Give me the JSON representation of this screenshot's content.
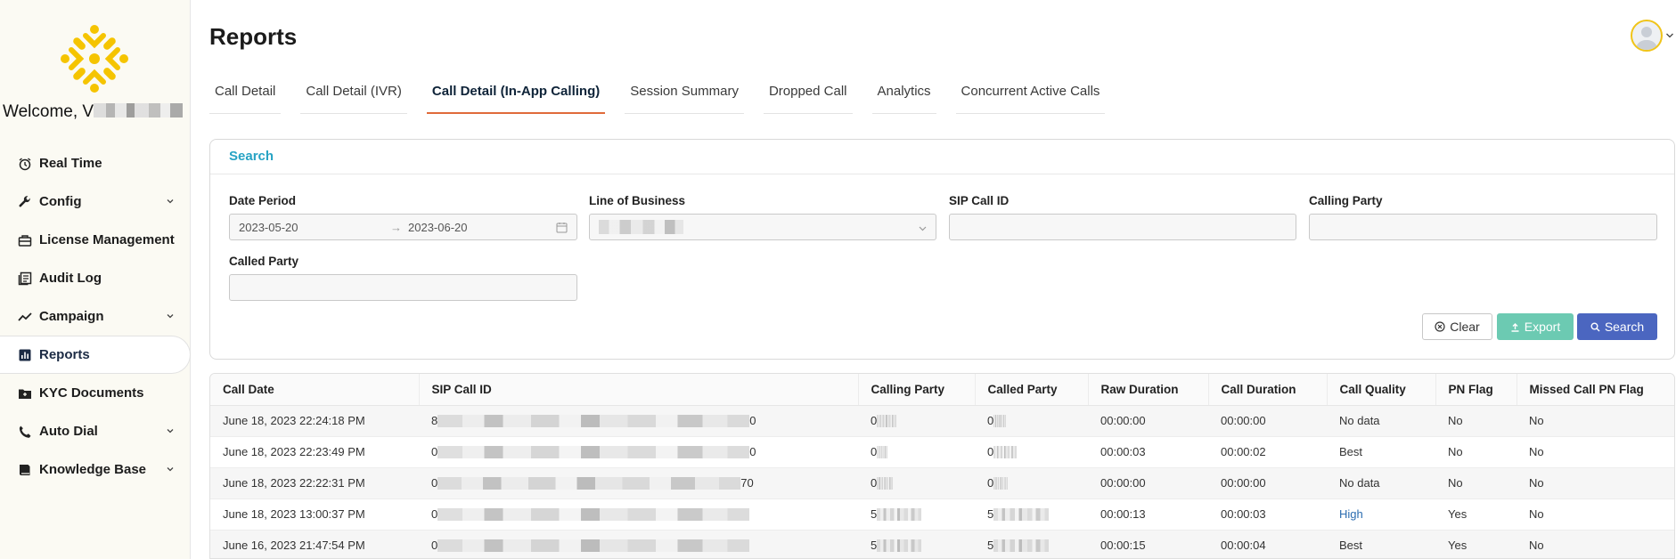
{
  "sidebar": {
    "welcome": "Welcome, V",
    "items": [
      {
        "label": "Real Time",
        "icon": "alarm-clock-icon",
        "expandable": false
      },
      {
        "label": "Config",
        "icon": "wrench-icon",
        "expandable": true
      },
      {
        "label": "License Management",
        "icon": "license-icon",
        "expandable": false
      },
      {
        "label": "Audit Log",
        "icon": "audit-log-icon",
        "expandable": false
      },
      {
        "label": "Campaign",
        "icon": "trend-line-icon",
        "expandable": true
      },
      {
        "label": "Reports",
        "icon": "bar-chart-icon",
        "expandable": false,
        "active": true
      },
      {
        "label": "KYC Documents",
        "icon": "folder-icon",
        "expandable": false
      },
      {
        "label": "Auto Dial",
        "icon": "phone-icon",
        "expandable": true
      },
      {
        "label": "Knowledge Base",
        "icon": "book-icon",
        "expandable": true
      }
    ]
  },
  "header": {
    "title": "Reports"
  },
  "tabs": [
    {
      "label": "Call Detail"
    },
    {
      "label": "Call Detail (IVR)"
    },
    {
      "label": "Call Detail (In-App Calling)",
      "active": true
    },
    {
      "label": "Session Summary"
    },
    {
      "label": "Dropped Call"
    },
    {
      "label": "Analytics"
    },
    {
      "label": "Concurrent Active Calls"
    }
  ],
  "search": {
    "title": "Search",
    "date_period_label": "Date Period",
    "date_start": "2023-05-20",
    "date_end": "2023-06-20",
    "date_separator": "→",
    "line_of_business_label": "Line of Business",
    "sip_call_id_label": "SIP Call ID",
    "calling_party_label": "Calling Party",
    "called_party_label": "Called Party",
    "clear_label": "Clear",
    "export_label": "Export",
    "search_label": "Search"
  },
  "table": {
    "columns": [
      "Call Date",
      "SIP Call ID",
      "Calling Party",
      "Called Party",
      "Raw Duration",
      "Call Duration",
      "Call Quality",
      "PN Flag",
      "Missed Call PN Flag"
    ],
    "rows": [
      {
        "call_date": "June 18, 2023 22:24:18 PM",
        "sip_prefix": "8",
        "sip_suffix": "0",
        "calling": "0",
        "called": "0",
        "raw_duration": "00:00:00",
        "call_duration": "00:00:00",
        "quality": "No data",
        "pn_flag": "No",
        "missed_pn_flag": "No"
      },
      {
        "call_date": "June 18, 2023 22:23:49 PM",
        "sip_prefix": "0",
        "sip_suffix": "0",
        "calling": "0",
        "called": "0",
        "raw_duration": "00:00:03",
        "call_duration": "00:00:02",
        "quality": "Best",
        "pn_flag": "No",
        "missed_pn_flag": "No"
      },
      {
        "call_date": "June 18, 2023 22:22:31 PM",
        "sip_prefix": "0",
        "sip_suffix": "70",
        "calling": "0",
        "called": "0",
        "raw_duration": "00:00:00",
        "call_duration": "00:00:00",
        "quality": "No data",
        "pn_flag": "No",
        "missed_pn_flag": "No"
      },
      {
        "call_date": "June 18, 2023 13:00:37 PM",
        "sip_prefix": "0",
        "sip_suffix": "",
        "calling": "5",
        "called": "5",
        "raw_duration": "00:00:13",
        "call_duration": "00:00:03",
        "quality": "High",
        "pn_flag": "Yes",
        "missed_pn_flag": "No"
      },
      {
        "call_date": "June 16, 2023 21:47:54 PM",
        "sip_prefix": "0",
        "sip_suffix": "",
        "calling": "5",
        "called": "5",
        "raw_duration": "00:00:15",
        "call_duration": "00:00:04",
        "quality": "Best",
        "pn_flag": "Yes",
        "missed_pn_flag": "No"
      }
    ]
  },
  "colors": {
    "accent": "#e06a3a",
    "logo": "#f5c400",
    "search_title": "#27a3c4",
    "export_button": "#6ccab2",
    "search_button": "#4b66c0"
  }
}
